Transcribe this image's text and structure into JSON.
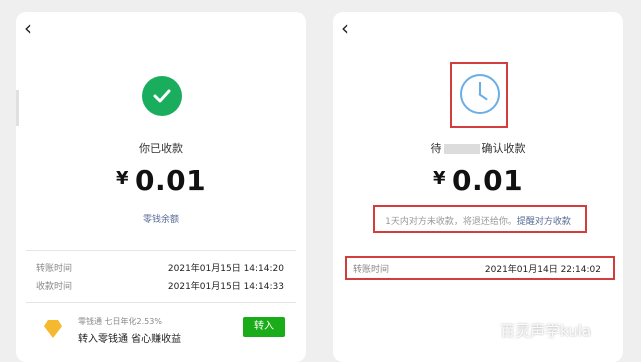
{
  "left": {
    "back_icon": "‹",
    "status": "你已收款",
    "currency": "¥",
    "amount": "0.01",
    "balance_link": "零钱余额",
    "rows": [
      {
        "label": "转账时间",
        "value": "2021年01月15日 14:14:20"
      },
      {
        "label": "收款时间",
        "value": "2021年01月15日 14:14:33"
      }
    ],
    "promo": {
      "sub": "零钱通 七日年化2.53%",
      "main": "转入零钱通 省心赚收益",
      "button": "转入"
    }
  },
  "right": {
    "back_icon": "‹",
    "status_prefix": "待",
    "status_suffix": "确认收款",
    "currency": "¥",
    "amount": "0.01",
    "notice_text": "1天内对方未收款，将退还给你。",
    "notice_link": "提醒对方收款",
    "rows": [
      {
        "label": "转账时间",
        "value": "2021年01月14日 22:14:02"
      }
    ]
  },
  "watermark": "百灵声学kula",
  "colors": {
    "success_green": "#1aad5e",
    "clock_blue": "#6aaee8",
    "highlight_red": "#d23d3d",
    "link_blue": "#576b95"
  }
}
